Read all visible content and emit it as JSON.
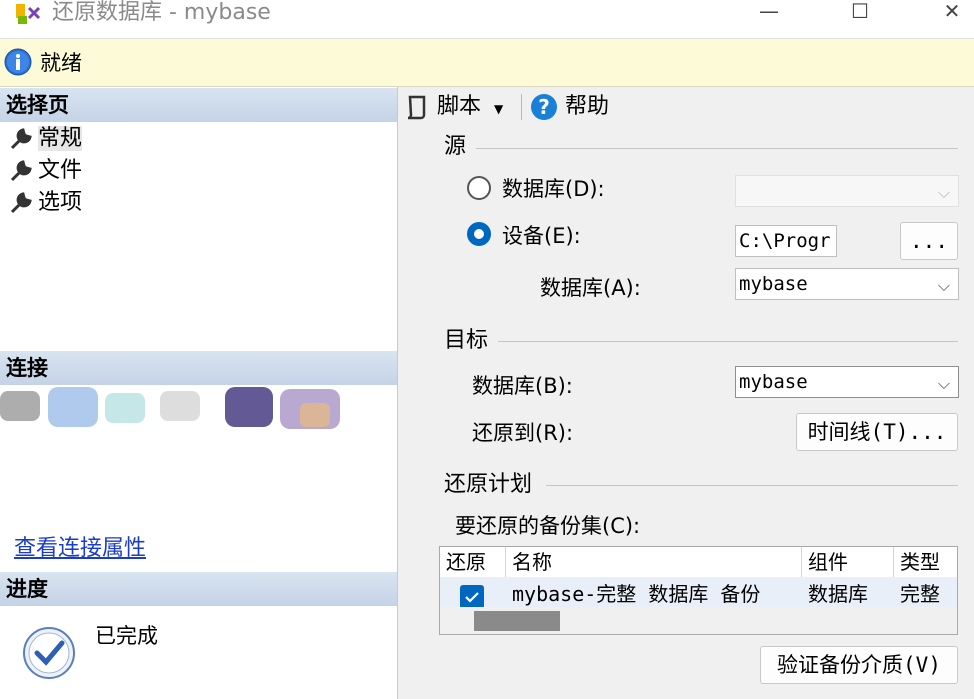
{
  "window": {
    "title": "还原数据库 - mybase",
    "controls": {
      "minimize": "—",
      "maximize": "☐",
      "close": "✕"
    }
  },
  "status": {
    "text": "就绪"
  },
  "left": {
    "select_page_header": "选择页",
    "pages": [
      "常规",
      "文件",
      "选项"
    ],
    "connection_header": "连接",
    "view_connection_link": "查看连接属性",
    "progress_header": "进度",
    "progress_text": "已完成"
  },
  "toolbar": {
    "script": "脚本",
    "help": "帮助"
  },
  "source": {
    "group": "源",
    "database_radio": "数据库(D):",
    "device_radio": "设备(E):",
    "device_path": "C:\\Progr",
    "browse_label": "...",
    "database_label": "数据库(A):",
    "database_value": "mybase",
    "selected_option": "设备(E):"
  },
  "target": {
    "group": "目标",
    "database_label": "数据库(B):",
    "database_value": "mybase",
    "restore_to_label": "还原到(R):",
    "timeline_button": "时间线(T)..."
  },
  "plan": {
    "group": "还原计划",
    "backup_sets_label": "要还原的备份集(C):",
    "columns": [
      "还原",
      "名称",
      "组件",
      "类型"
    ],
    "rows": [
      {
        "restore": true,
        "name": "mybase-完整 数据库 备份",
        "component": "数据库",
        "type": "完整"
      }
    ],
    "verify_button": "验证备份介质(V)"
  },
  "colors": {
    "accent": "#0067c0",
    "status_bg": "#fdfbd7",
    "header_bg": "#c4d3e6",
    "link": "#1a3dc7"
  }
}
